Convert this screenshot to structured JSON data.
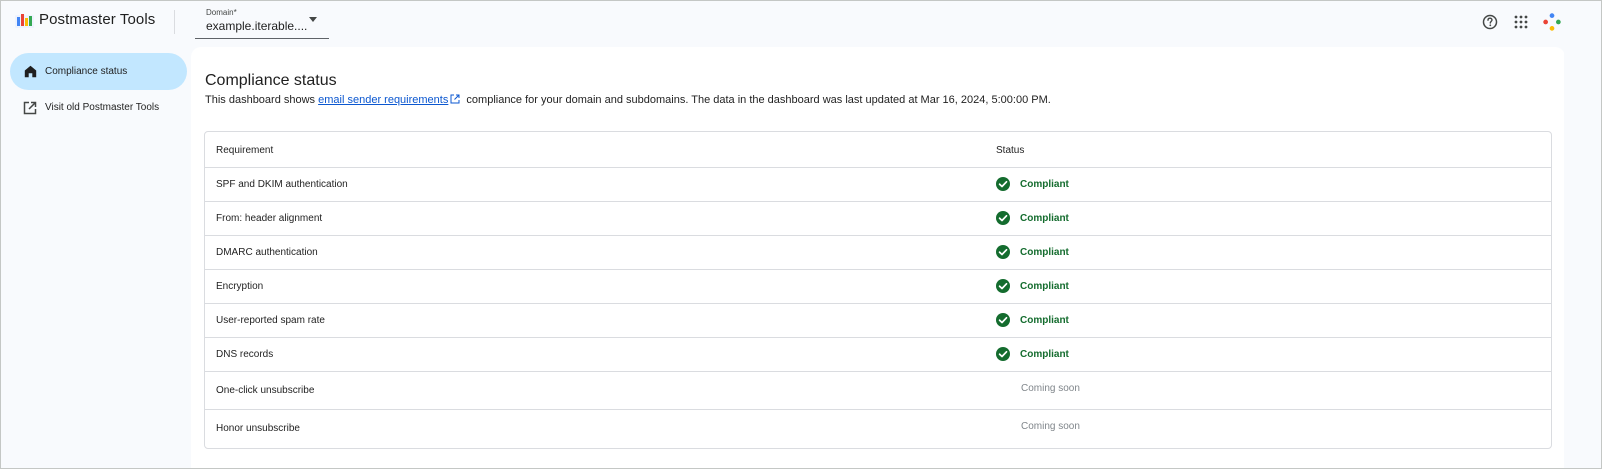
{
  "app": {
    "title": "Postmaster Tools"
  },
  "domain_select": {
    "label": "Domain*",
    "value": "example.iterable...."
  },
  "header_icons": [
    "help-icon",
    "apps-grid-icon",
    "account-dots-icon"
  ],
  "sidebar": {
    "items": [
      {
        "label": "Compliance status",
        "icon": "home-icon",
        "active": true
      },
      {
        "label": "Visit old Postmaster Tools",
        "icon": "open-external-icon",
        "active": false
      }
    ]
  },
  "main": {
    "title": "Compliance status",
    "description_prefix": "This dashboard shows ",
    "description_link": "email sender requirements",
    "description_suffix": " compliance for your domain and subdomains. The data in the dashboard was last updated at Mar 16, 2024, 5:00:00 PM."
  },
  "table": {
    "headers": {
      "requirement": "Requirement",
      "status": "Status"
    },
    "rows": [
      {
        "requirement": "SPF and DKIM authentication",
        "status": "Compliant",
        "type": "compliant"
      },
      {
        "requirement": "From: header alignment",
        "status": "Compliant",
        "type": "compliant"
      },
      {
        "requirement": "DMARC authentication",
        "status": "Compliant",
        "type": "compliant"
      },
      {
        "requirement": "Encryption",
        "status": "Compliant",
        "type": "compliant"
      },
      {
        "requirement": "User-reported spam rate",
        "status": "Compliant",
        "type": "compliant"
      },
      {
        "requirement": "DNS records",
        "status": "Compliant",
        "type": "compliant"
      },
      {
        "requirement": "One-click unsubscribe",
        "status": "Coming soon",
        "type": "soon"
      },
      {
        "requirement": "Honor unsubscribe",
        "status": "Coming soon",
        "type": "soon"
      }
    ]
  },
  "colors": {
    "compliant": "#146c2e",
    "check_fill": "#146c2e",
    "active_nav": "#c2e7ff",
    "link": "#0b57d0",
    "coming_soon": "#80868b"
  }
}
